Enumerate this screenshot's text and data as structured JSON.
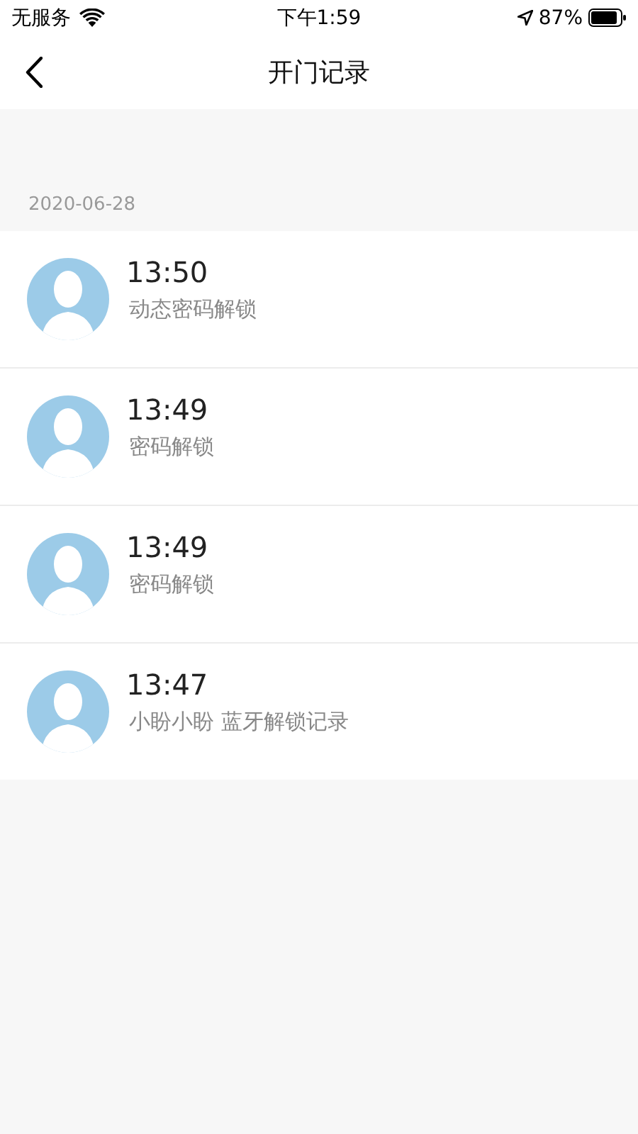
{
  "status_bar": {
    "carrier": "无服务",
    "time": "下午1:59",
    "battery": "87%"
  },
  "nav": {
    "title": "开门记录"
  },
  "section": {
    "date": "2020-06-28"
  },
  "records": [
    {
      "time": "13:50",
      "description": "动态密码解锁"
    },
    {
      "time": "13:49",
      "description": "密码解锁"
    },
    {
      "time": "13:49",
      "description": "密码解锁"
    },
    {
      "time": "13:47",
      "description": "小盼小盼 蓝牙解锁记录"
    }
  ]
}
